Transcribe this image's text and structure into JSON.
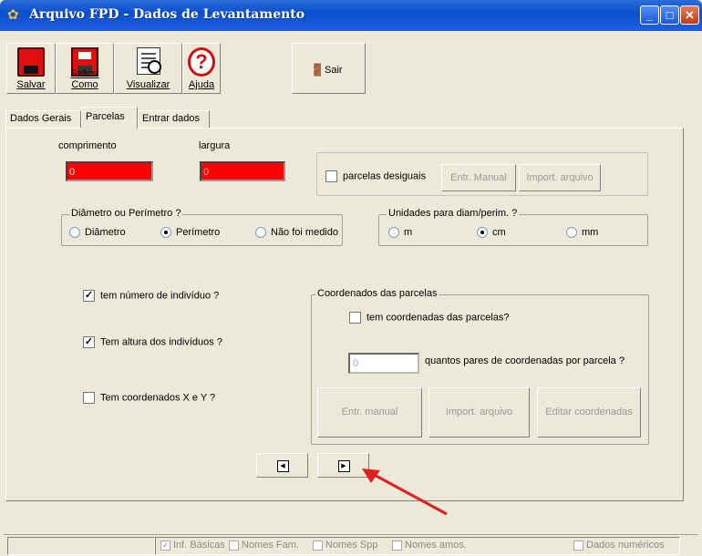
{
  "window": {
    "title": "Arquivo FPD - Dados de Levantamento"
  },
  "toolbar": {
    "salvar": "Salvar",
    "salvar_como": "Salvar Como",
    "visualizar": "Visualizar",
    "ajuda": "Ajuda",
    "sair": "Sair"
  },
  "tabs": [
    "Dados Gerais",
    "Parcelas",
    "Entrar dados"
  ],
  "active_tab": "Parcelas",
  "parcelas": {
    "comprimento_label": "comprimento",
    "comprimento_value": "0",
    "largura_label": "largura",
    "largura_value": "0",
    "desiguais_label": "parcelas desiguais",
    "entr_manual": "Entr. Manual",
    "import_arquivo": "Import. arquivo"
  },
  "diametro": {
    "title": "Diâmetro ou Perímetro ?",
    "options": [
      "Diâmetro",
      "Perímetro",
      "Não foi medido"
    ],
    "selected": "Perímetro"
  },
  "unidades": {
    "title": "Unidades para diam/perim. ?",
    "options": [
      "m",
      "cm",
      "mm"
    ],
    "selected": "cm"
  },
  "checks": {
    "numero": "tem número de indivíduo ?",
    "altura": "Tem altura dos indivíduos ?",
    "coordenados": "Tem coordenados X e Y ?"
  },
  "coordenados": {
    "title": "Coordenados das parcelas",
    "tem_label": "tem coordenadas das parcelas?",
    "pares_value": "0",
    "pares_label": "quantos pares de coordenadas por parcela ?",
    "entr_manual": "Entr. manual",
    "import_arquivo": "Import. arquivo",
    "editar": "Editar coordenadas"
  },
  "status": {
    "basicas": "Inf. Básicas",
    "fam": "Nomes Fam.",
    "spp": "Nomes Spp",
    "amos": "Nomes amos.",
    "numericos": "Dados numéricos"
  },
  "colors": {
    "accent_red": "#ff0000",
    "titlebar": "#0a4fcc",
    "arrow": "#e02020"
  }
}
